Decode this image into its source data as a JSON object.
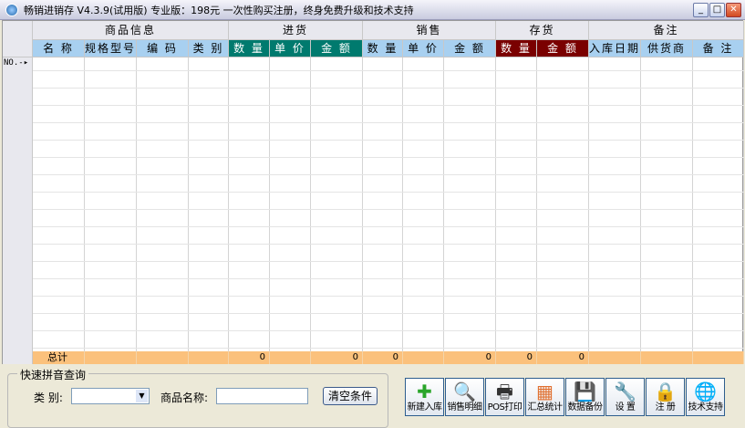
{
  "window": {
    "title": "畅销进销存 V4.3.9(试用版)   专业版：198元 一次性购买注册，终身免费升级和技术支持"
  },
  "groups": [
    "商品信息",
    "进货",
    "销售",
    "存货",
    "备注"
  ],
  "columns": [
    "名 称",
    "规格型号",
    "编 码",
    "类 别",
    "数 量",
    "单 价",
    "金 额",
    "数 量",
    "单 价",
    "金 额",
    "数 量",
    "金 额",
    "入库日期",
    "供货商",
    "备 注"
  ],
  "row_marker": "NO.-",
  "total": {
    "label": "总计",
    "purchase_qty": "0",
    "purchase_amount": "0",
    "sales_qty": "0",
    "sales_amount": "0",
    "stock_qty": "0",
    "stock_amount": "0"
  },
  "search": {
    "title": "快速拼音查询",
    "category_label": "类 别:",
    "category_value": "",
    "name_label": "商品名称:",
    "name_value": "",
    "clear_button": "清空条件"
  },
  "toolbar": [
    {
      "label": "新建入库",
      "icon": "plus-icon"
    },
    {
      "label": "销售明细",
      "icon": "magnifier-icon"
    },
    {
      "label": "POS打印",
      "icon": "printer-icon"
    },
    {
      "label": "汇总统计",
      "icon": "calendar-icon"
    },
    {
      "label": "数据备份",
      "icon": "floppy-icon"
    },
    {
      "label": "设 置",
      "icon": "wrench-icon"
    },
    {
      "label": "注 册",
      "icon": "lock-icon"
    },
    {
      "label": "技术支持",
      "icon": "globe-icon"
    }
  ]
}
